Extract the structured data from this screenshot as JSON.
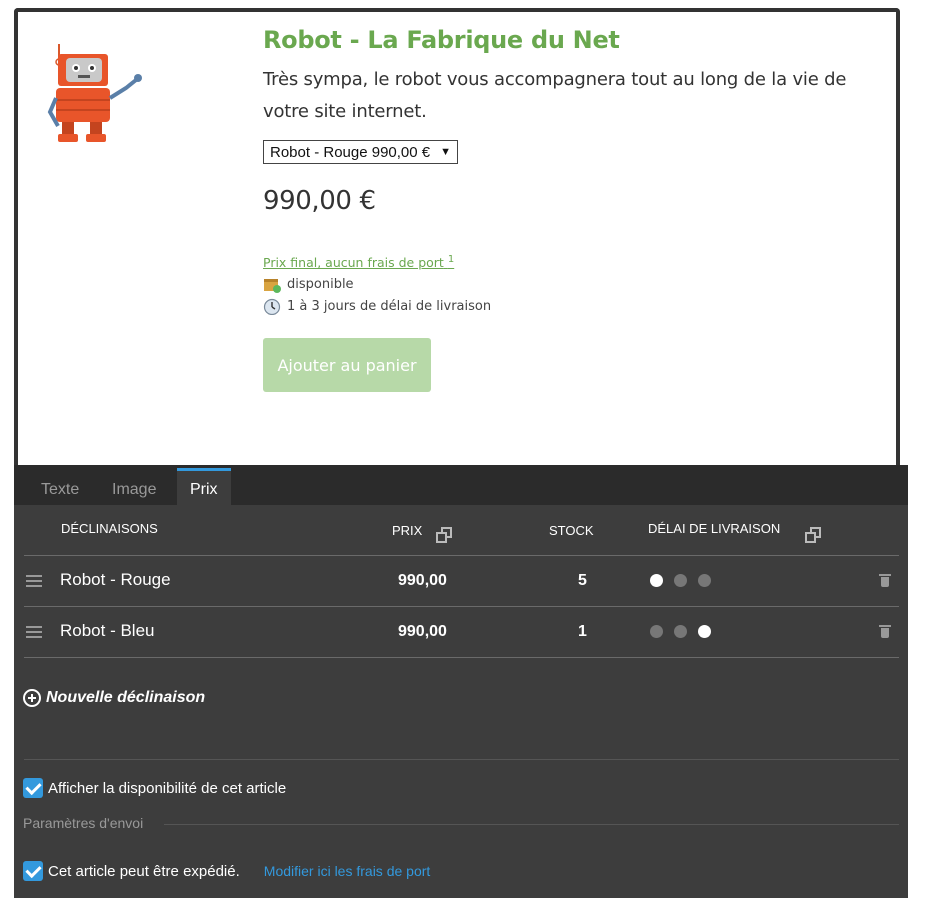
{
  "product": {
    "title": "Robot - La Fabrique du Net",
    "description": "Très sympa, le robot vous accompagnera tout au long de la vie de votre site internet.",
    "variant_selected": "Robot - Rouge 990,00 €",
    "price": "990,00 €",
    "shipping_link": "Prix final, aucun frais de port",
    "shipping_footnote": "1",
    "availability": "disponible",
    "delivery": "1 à 3 jours de délai de livraison",
    "cart_button": "Ajouter au panier",
    "colors": {
      "accent": "#6aa84f",
      "cart": "#b7d9a8"
    }
  },
  "tabs": [
    {
      "label": "Texte"
    },
    {
      "label": "Image"
    },
    {
      "label": "Prix",
      "active": true
    }
  ],
  "table": {
    "headers": {
      "variants": "DÉCLINAISONS",
      "price": "PRIX",
      "stock": "STOCK",
      "delay": "DÉLAI DE LIVRAISON"
    },
    "rows": [
      {
        "name": "Robot - Rouge",
        "price": "990,00",
        "stock": "5",
        "delay_active": 1
      },
      {
        "name": "Robot - Bleu",
        "price": "990,00",
        "stock": "1",
        "delay_active": 3
      }
    ]
  },
  "new_variant": "Nouvelle déclinaison",
  "show_availability": "Afficher la disponibilité de cet article",
  "shipping_section": "Paramètres d'envoi",
  "shippable": "Cet article peut être expédié.",
  "modify_shipping": "Modifier ici les frais de port"
}
